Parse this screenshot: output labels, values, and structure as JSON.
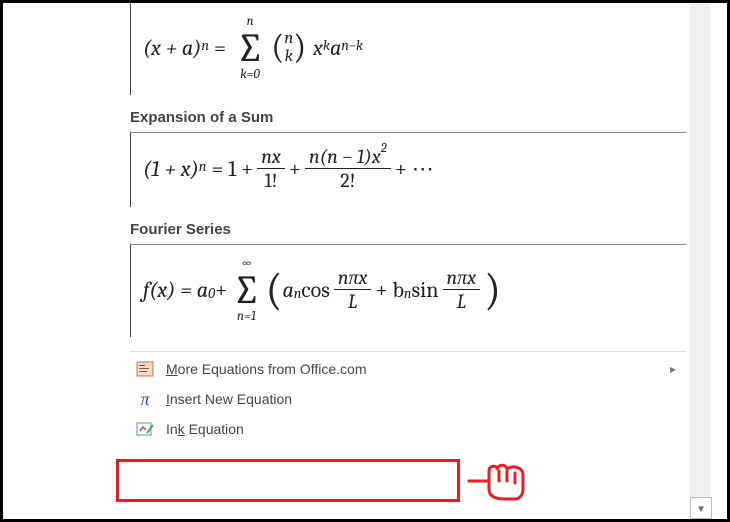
{
  "equations": {
    "binomial": {
      "lhs_base": "(x + a)",
      "lhs_exp": "n",
      "sum_upper": "n",
      "sum_lower": "k=0",
      "binom_top": "n",
      "binom_bot": "k",
      "term_x": "x",
      "term_x_exp": "k",
      "term_a": "a",
      "term_a_exp": "n−k"
    },
    "expansion": {
      "heading": "Expansion of a Sum",
      "lhs_base": "(1 + x)",
      "lhs_exp": "n",
      "plus1": "= 1 +",
      "f1_num": "nx",
      "f1_den": "1!",
      "plus2": "+",
      "f2_num": "n(n − 1)x",
      "f2_num_exp": "2",
      "f2_den": "2!",
      "tail": "+ ⋯"
    },
    "fourier": {
      "heading": "Fourier Series",
      "lhs": "f(x) = a",
      "a0_sub": "0",
      "plus": " + ",
      "sum_upper": "∞",
      "sum_lower": "n=1",
      "an": "a",
      "an_sub": "n",
      "cos": " cos",
      "f1_num": "nπx",
      "f1_den": "L",
      "mid": " + b",
      "bn_sub": "n",
      "sin": " sin",
      "f2_num": "nπx",
      "f2_den": "L"
    }
  },
  "menu": {
    "more": {
      "label_pre": "",
      "label_u": "M",
      "label_post": "ore Equations from Office.com"
    },
    "insert": {
      "pi": "π",
      "label_pre": "",
      "label_u": "I",
      "label_post": "nsert New Equation"
    },
    "ink": {
      "label_pre": "In",
      "label_u": "k",
      "label_post": " Equation"
    }
  }
}
